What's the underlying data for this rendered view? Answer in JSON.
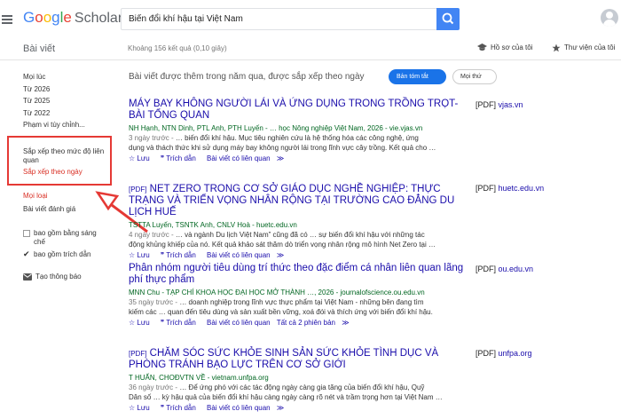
{
  "header": {
    "logo_letters": [
      "G",
      "o",
      "o",
      "g",
      "l",
      "e"
    ],
    "logo_product": "Scholar",
    "search_query": "Biến đổi khí hậu tại Việt Nam"
  },
  "subheader": {
    "section": "Bài viết",
    "results": "Khoảng 156 kết quả (0,10 giây)",
    "profile": "Hồ sơ của tôi",
    "library": "Thư viện của tôi"
  },
  "sidebar": {
    "time_filters": [
      "Mọi lúc",
      "Từ 2026",
      "Từ 2025",
      "Từ 2022",
      "Phạm vi tùy chỉnh..."
    ],
    "sort_relevance": "Sắp xếp theo mức độ liên quan",
    "sort_date": "Sắp xếp theo ngày",
    "type_all": "Mọi loại",
    "type_review": "Bài viết đánh giá",
    "include_patents": "bao gồm bằng sáng chế",
    "include_citations": "bao gồm trích dẫn",
    "create_alert": "Tạo thông báo"
  },
  "main": {
    "notice": "Bài viết được thêm trong năm qua, được sắp xếp theo ngày",
    "chip_summary": "Bản tóm tắt",
    "chip_any": "Mọi thứ",
    "actions": {
      "save": "Lưu",
      "cite": "Trích dẫn",
      "related": "Bài viết có liên quan",
      "all_versions": "Tất cả 2 phiên bản"
    },
    "results": [
      {
        "pdf_prefix": "",
        "title": "MÁY BAY KHÔNG NGƯỜI LÁI VÀ ỨNG DỤNG TRONG TRỒNG TRỌT-BÀI TỔNG QUAN",
        "meta": "NH Hạnh, NTN Dinh, PTL Anh, PTH Luyến - … học Nông nghiệp Việt Nam, 2026 - vie.vjas.vn",
        "snippet_date": "3 ngày trước -",
        "snippet_1": "… biến đổi khí hậu. Mục tiêu nghiên cứu là hệ thống hóa các công nghệ, ứng",
        "snippet_2": "dụng và thách thức khi sử dụng máy bay không người lái trong lĩnh vực cây trồng. Kết quả cho …",
        "side_tag": "[PDF]",
        "side_domain": "vjas.vn",
        "extra_action": ""
      },
      {
        "pdf_prefix": "[PDF]",
        "title": "NET ZERO TRONG CƠ SỞ GIÁO DỤC NGHỀ NGHIỆP: THỰC TRẠNG VÀ TRIỂN VỌNG NHÂN RỘNG TẠI TRƯỜNG CAO ĐẲNG DU LỊCH HUẾ",
        "meta": "TSTTA Luyến, TSNTK Anh, CNLV Hoà - huetc.edu.vn",
        "snippet_date": "4 ngày trước -",
        "snippet_1": "… và ngành Du lịch Việt Nam” cũng đã có … sự biến đổi khí hậu với những tác",
        "snippet_2": "động khủng khiếp của nó. Kết quả khảo sát thăm dò triển vọng nhân rộng mô hình Net Zero tại …",
        "side_tag": "[PDF]",
        "side_domain": "huetc.edu.vn",
        "extra_action": ""
      },
      {
        "pdf_prefix": "",
        "title": "Phân nhóm người tiêu dùng trí thức theo đặc điểm cá nhân liên quan lãng phí thực phẩm",
        "meta": "MNN Chu - TẠP CHÍ KHOA HỌC ĐẠI HỌC MỞ THÀNH …, 2026 - journalofscience.ou.edu.vn",
        "snippet_date": "35 ngày trước -",
        "snippet_1": "… doanh nghiệp trong lĩnh vực thực phẩm tại Việt Nam - những bên đang tìm",
        "snippet_2": "kiếm các … quan đến tiêu dùng và sản xuất bền vững, xoá đói và thích ứng với biến đổi khí hậu.",
        "side_tag": "[PDF]",
        "side_domain": "ou.edu.vn",
        "extra_action": "all_versions"
      },
      {
        "pdf_prefix": "[PDF]",
        "title": "CHĂM SÓC SỨC KHỎE SINH SẢN SỨC KHỎE TÌNH DỤC VÀ PHÒNG TRÁNH BẠO LỰC TRÊN CƠ SỞ GIỚI",
        "meta": "T HUẤN, CHOĐVTN VỀ - vietnam.unfpa.org",
        "snippet_date": "36 ngày trước -",
        "snippet_1": "… Để ứng phó với các tác động ngày càng gia tăng của biến đổi khí hậu, Quỹ",
        "snippet_2": "Dân số … kỳ hậu quả của biến đổi khí hậu càng ngày càng rõ nét và trầm trọng hơn tại Việt Nam …",
        "side_tag": "[PDF]",
        "side_domain": "unfpa.org",
        "extra_action": ""
      }
    ]
  },
  "colors": {
    "link": "#1a0dab",
    "meta_green": "#006621",
    "selected_red": "#d93025",
    "highlight_red": "#e53935",
    "search_blue": "#4285f4",
    "chip_blue": "#1a73e8"
  }
}
